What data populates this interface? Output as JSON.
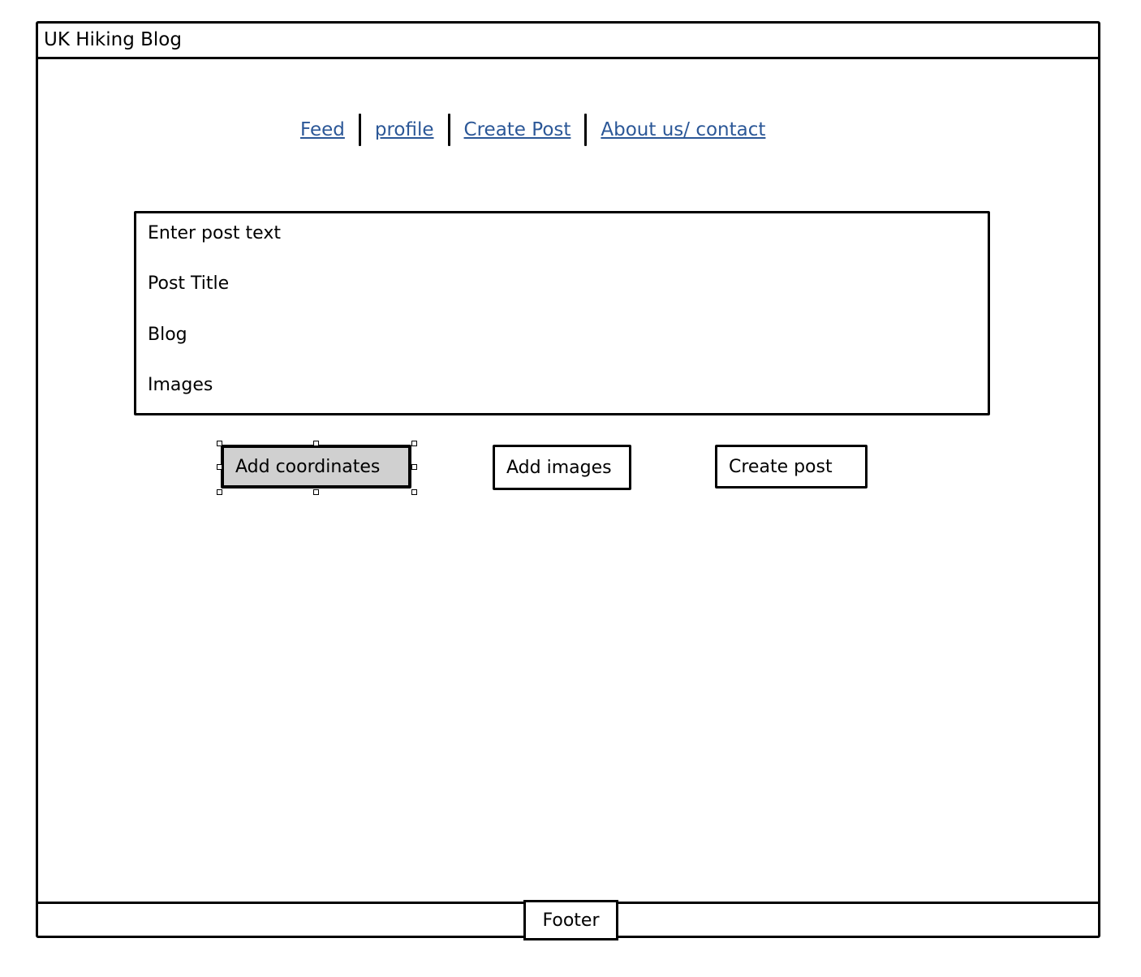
{
  "app": {
    "title": "UK Hiking Blog"
  },
  "nav": {
    "items": [
      {
        "label": "Feed"
      },
      {
        "label": "profile"
      },
      {
        "label": "Create Post"
      },
      {
        "label": "About us/ contact"
      }
    ],
    "link_color": "#2b5797"
  },
  "post_form": {
    "fields": [
      {
        "label": "Enter post text"
      },
      {
        "label": "Post Title"
      },
      {
        "label": "Blog"
      },
      {
        "label": "Images"
      }
    ]
  },
  "buttons": {
    "add_coordinates": "Add coordinates",
    "add_images": "Add images",
    "create_post": "Create post"
  },
  "footer": {
    "label": "Footer"
  }
}
